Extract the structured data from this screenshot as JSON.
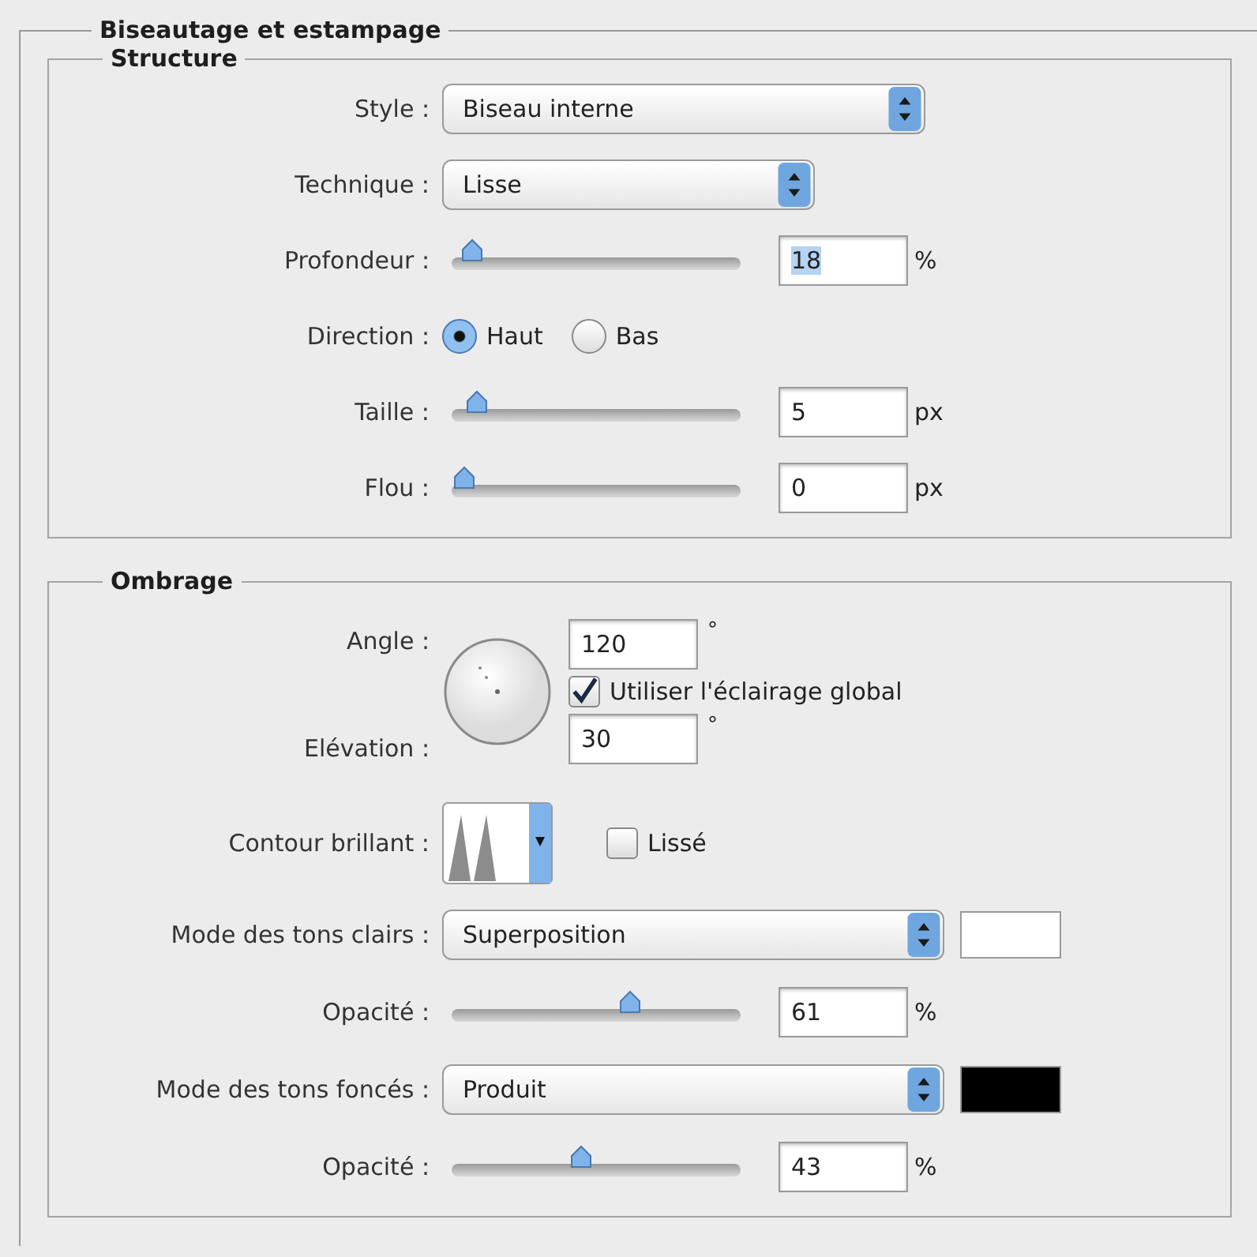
{
  "panel": {
    "title": "Biseautage et estampage"
  },
  "sections": [
    {
      "title": "Structure",
      "rows": [
        {
          "kind": "select",
          "label": "Style :",
          "value": "Biseau interne"
        },
        {
          "kind": "select",
          "label": "Technique :",
          "value": "Lisse"
        },
        {
          "kind": "slider",
          "label": "Profondeur :",
          "level": 0.03,
          "value": "18",
          "unit": "%",
          "text_selected": true
        },
        {
          "kind": "radio",
          "label": "Direction :",
          "options": [
            {
              "label": "Haut",
              "selected": true
            },
            {
              "label": "Bas",
              "selected": false
            }
          ]
        },
        {
          "kind": "slider",
          "label": "Taille :",
          "level": 0.05,
          "value": "5",
          "unit": "px",
          "text_selected": false
        },
        {
          "kind": "slider",
          "label": "Flou :",
          "level": 0.0,
          "value": "0",
          "unit": "px",
          "text_selected": false
        }
      ]
    },
    {
      "title": "Ombrage",
      "rows": [
        {
          "kind": "angle",
          "angle_label": "Angle :",
          "angle_value": "120",
          "angle_unit": "°",
          "global_light": {
            "label": "Utiliser l'éclairage global",
            "checked": true
          },
          "elevation_label": "Elévation :",
          "elevation_value": "30",
          "elevation_unit": "°"
        },
        {
          "kind": "contour",
          "label": "Contour brillant :",
          "smooth": {
            "label": "Lissé",
            "checked": false
          }
        },
        {
          "kind": "select",
          "label": "Mode des tons clairs :",
          "value": "Superposition",
          "color": "#ffffff"
        },
        {
          "kind": "slider",
          "label": "Opacité :",
          "level": 0.62,
          "value": "61",
          "unit": "%",
          "text_selected": false
        },
        {
          "kind": "select",
          "label": "Mode des tons foncés :",
          "value": "Produit",
          "color": "#000000"
        },
        {
          "kind": "slider",
          "label": "Opacité :",
          "level": 0.44,
          "value": "43",
          "unit": "%",
          "text_selected": false
        }
      ]
    }
  ]
}
